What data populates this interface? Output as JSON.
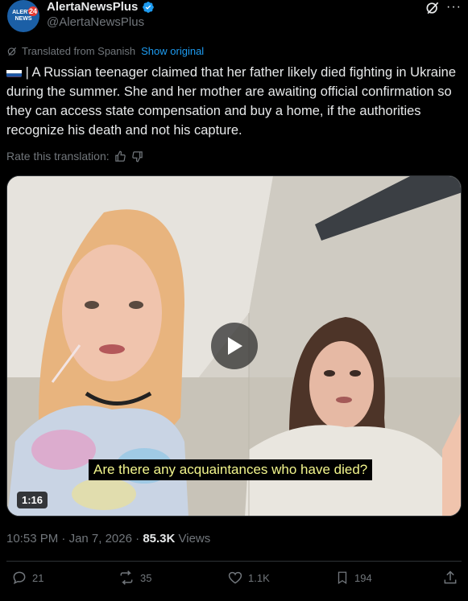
{
  "author": {
    "display_name": "AlertaNewsPlus",
    "handle": "@AlertaNewsPlus",
    "avatar_text": "ALERTA NEWS",
    "avatar_badge": "24"
  },
  "translation": {
    "label": "Translated from Spanish",
    "show_original": "Show original"
  },
  "post": {
    "text": " | A Russian teenager claimed that her father likely died fighting in Ukraine during the summer. She and her mother are awaiting official confirmation so they can access state compensation and buy a home, if the authorities recognize his death and not his capture."
  },
  "rate": {
    "label": "Rate this translation:"
  },
  "media": {
    "caption": "Are there any acquaintances who have died?",
    "duration": "1:16"
  },
  "meta": {
    "time": "10:53 PM",
    "date": "Jan 7, 2026",
    "separator": "·",
    "views_count": "85.3K",
    "views_label": "Views"
  },
  "actions": {
    "replies": "21",
    "reposts": "35",
    "likes": "1.1K",
    "bookmarks": "194"
  },
  "colors": {
    "background": "#000000",
    "text": "#e7e9ea",
    "muted": "#71767b",
    "link": "#1d9bf0",
    "caption_text": "#f2f58c"
  }
}
